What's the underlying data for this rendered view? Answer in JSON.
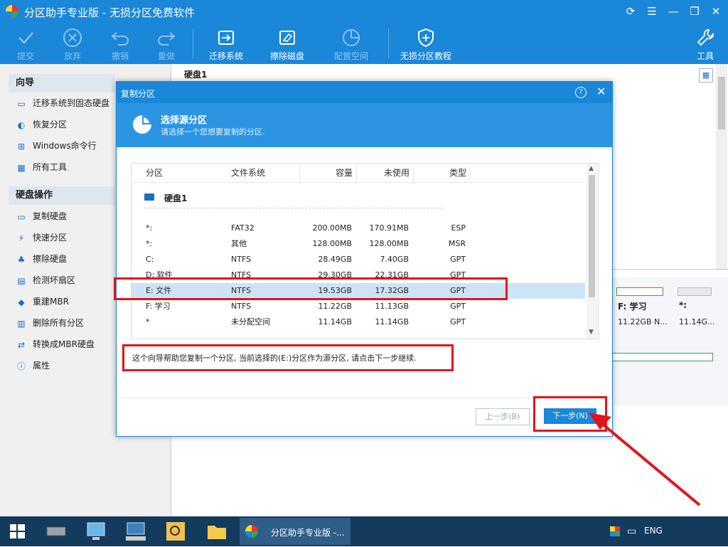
{
  "window": {
    "title": "分区助手专业版 - 无损分区免费软件"
  },
  "toolbar": {
    "commit": "提交",
    "discard": "放弃",
    "undo": "撤销",
    "redo": "重做",
    "migrate": "迁移系统",
    "wipe": "擦除磁盘",
    "allocate": "配置空间",
    "tutorial": "无损分区教程",
    "tools": "工具"
  },
  "left": {
    "wizard_title": "向导",
    "wizard_items": [
      "迁移系统到固态硬盘",
      "恢复分区",
      "Windows命令行",
      "所有工具"
    ],
    "disk_ops_title": "硬盘操作",
    "disk_items": [
      "复制硬盘",
      "快速分区",
      "擦除硬盘",
      "检测坏扇区",
      "重建MBR",
      "删除所有分区",
      "转换成MBR硬盘",
      "属性"
    ]
  },
  "main": {
    "disk_label": "硬盘1",
    "cards": [
      {
        "name": "F: 学习",
        "size": "11.22GB N..."
      },
      {
        "name": "*:",
        "size": "11.14G..."
      }
    ]
  },
  "dialog": {
    "title": "复制分区",
    "head_title": "选择源分区",
    "head_sub": "请选择一个您想要复制的分区.",
    "columns": [
      "分区",
      "文件系统",
      "容量",
      "未使用",
      "类型"
    ],
    "disk_row": "硬盘1",
    "rows": [
      {
        "part": "*:",
        "fs": "FAT32",
        "cap": "200.00MB",
        "free": "170.91MB",
        "type": "ESP"
      },
      {
        "part": "*:",
        "fs": "其他",
        "cap": "128.00MB",
        "free": "128.00MB",
        "type": "MSR"
      },
      {
        "part": "C:",
        "fs": "NTFS",
        "cap": "28.49GB",
        "free": "7.40GB",
        "type": "GPT"
      },
      {
        "part": "D:  软件",
        "fs": "NTFS",
        "cap": "29.30GB",
        "free": "22.31GB",
        "type": "GPT"
      },
      {
        "part": "E:  文件",
        "fs": "NTFS",
        "cap": "19.53GB",
        "free": "17.32GB",
        "type": "GPT"
      },
      {
        "part": "F:  学习",
        "fs": "NTFS",
        "cap": "11.22GB",
        "free": "11.13GB",
        "type": "GPT"
      },
      {
        "part": "*",
        "fs": "未分配空间",
        "cap": "11.14GB",
        "free": "11.14GB",
        "type": "GPT"
      }
    ],
    "selected_row": 4,
    "info": "这个向导帮助您复制一个分区, 当前选择的(E:)分区作为源分区, 请点击下一步继续.",
    "prev": "上一步(B)",
    "next": "下一步(N)"
  },
  "taskbar": {
    "app_label": "分区助手专业版 -...",
    "lang": "ENG"
  },
  "colors": {
    "accent": "#1a87d9",
    "highlight": "#cde4f7",
    "annotation": "#e2141b"
  }
}
